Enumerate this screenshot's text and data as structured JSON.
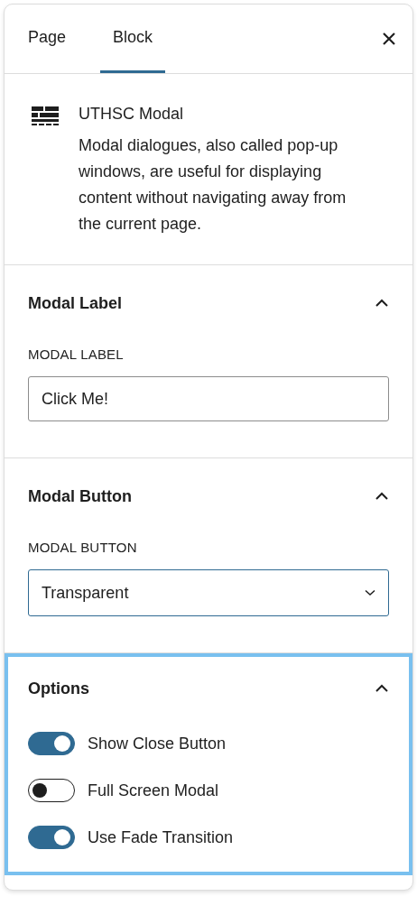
{
  "tabs": [
    {
      "label": "Page",
      "selected": false
    },
    {
      "label": "Block",
      "selected": true
    }
  ],
  "block": {
    "title": "UTHSC Modal",
    "description": "Modal dialogues, also called pop-up windows, are useful for displaying content without navigating away from the current page."
  },
  "panels": [
    {
      "kind": "text-field",
      "title": "Modal Label",
      "expanded": true,
      "highlighted": false,
      "field_label": "MODAL LABEL",
      "value": "Click Me!"
    },
    {
      "kind": "select",
      "title": "Modal Button",
      "expanded": true,
      "highlighted": false,
      "field_label": "MODAL BUTTON",
      "value": "Transparent"
    },
    {
      "kind": "toggles",
      "title": "Options",
      "expanded": true,
      "highlighted": true,
      "toggles": [
        {
          "label": "Show Close Button",
          "on": true
        },
        {
          "label": "Full Screen Modal",
          "on": false
        },
        {
          "label": "Use Fade Transition",
          "on": true
        }
      ]
    }
  ]
}
